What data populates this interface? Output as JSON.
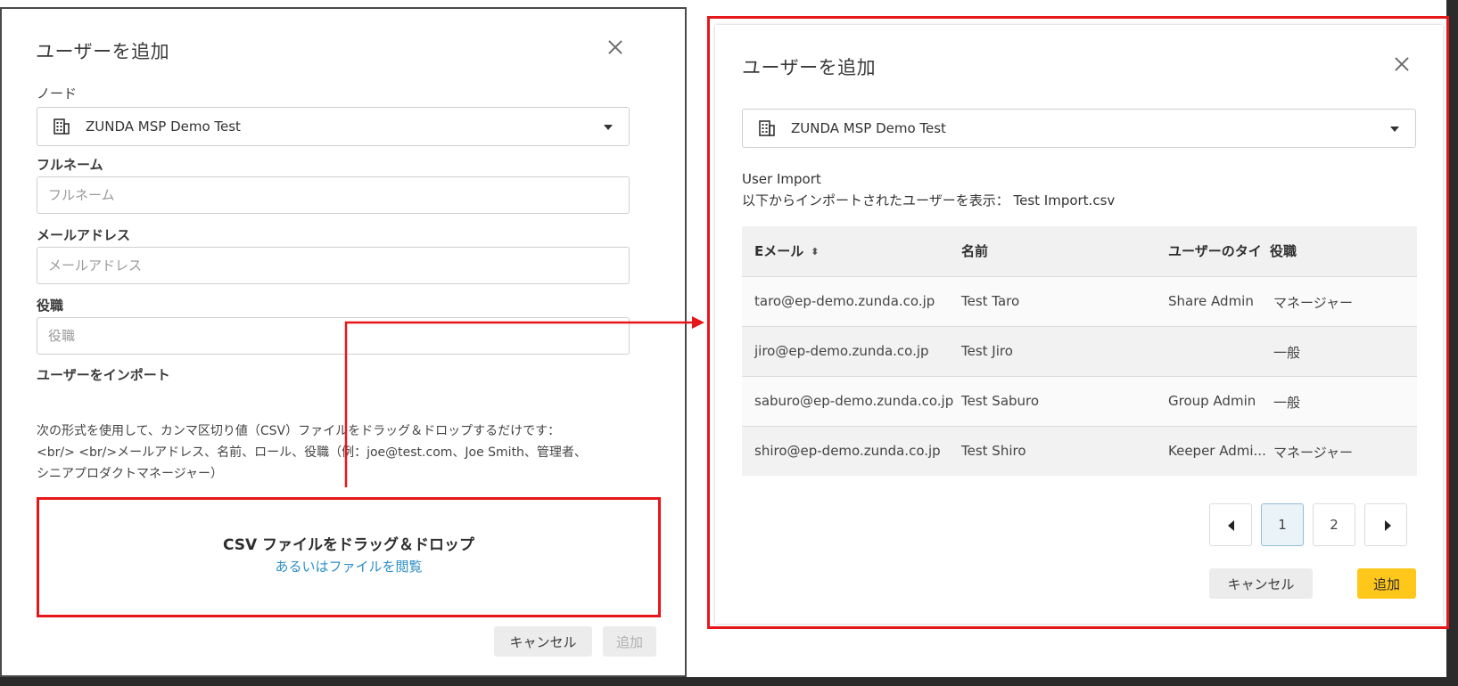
{
  "left_dialog": {
    "title": "ユーザーを追加",
    "node_label": "ノード",
    "node_value": "ZUNDA MSP Demo Test",
    "fullname_label": "フルネーム",
    "fullname_placeholder": "フルネーム",
    "email_label": "メールアドレス",
    "email_placeholder": "メールアドレス",
    "role_label": "役職",
    "role_placeholder": "役職",
    "import_title": "ユーザーをインポート",
    "import_desc_1": "次の形式を使用して、カンマ区切り値（CSV）ファイルをドラッグ＆ドロップするだけです：",
    "import_desc_2": "<br/> <br/>メールアドレス、名前、ロール、役職（例：joe@test.com、Joe Smith、管理者、",
    "import_desc_3": "シニアプロダクトマネージャー）",
    "drop_title": "CSV ファイルをドラッグ＆ドロップ",
    "drop_link": "あるいはファイルを閲覧",
    "cancel_label": "キャンセル",
    "add_label": "追加"
  },
  "right_dialog": {
    "title": "ユーザーを追加",
    "node_value": "ZUNDA MSP Demo Test",
    "import_heading": "User Import",
    "import_sub": "以下からインポートされたユーザーを表示： Test Import.csv",
    "columns": [
      "Eメール",
      "名前",
      "ユーザーのタイ",
      "役職"
    ],
    "rows": [
      [
        "taro@ep-demo.zunda.co.jp",
        "Test Taro",
        "Share Admin",
        "マネージャー"
      ],
      [
        "jiro@ep-demo.zunda.co.jp",
        "Test Jiro",
        "",
        "一般"
      ],
      [
        "saburo@ep-demo.zunda.co.jp",
        "Test Saburo",
        "Group Admin",
        "一般"
      ],
      [
        "shiro@ep-demo.zunda.co.jp",
        "Test Shiro",
        "Keeper Admi...",
        "マネージャー"
      ]
    ],
    "pagination": {
      "pages": [
        "1",
        "2"
      ],
      "current": "1"
    },
    "cancel_label": "キャンセル",
    "add_label": "追加"
  },
  "colors": {
    "highlight_red": "#e5171b",
    "primary_yellow": "#ffc71a",
    "link_blue": "#2d8fc6"
  },
  "icons": [
    "close-icon",
    "building-icon",
    "caret-down-icon",
    "sort-icon",
    "prev-page-icon",
    "next-page-icon",
    "arrow-connector"
  ]
}
